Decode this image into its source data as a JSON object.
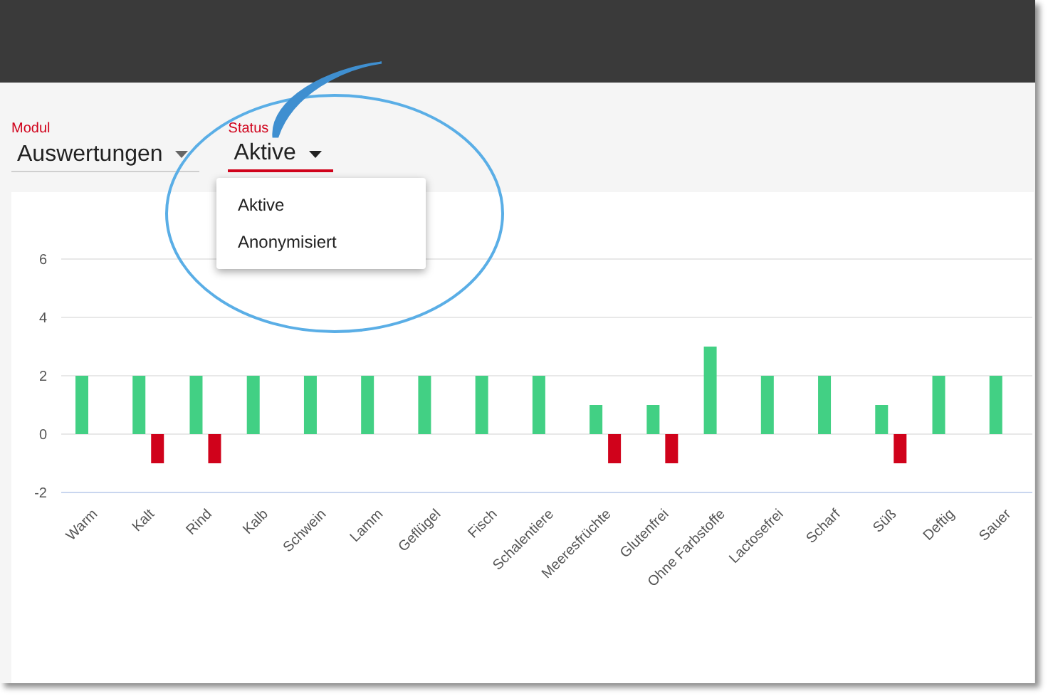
{
  "filters": [
    {
      "label": "Modul",
      "value": "Auswertungen",
      "focused": false
    },
    {
      "label": "Status",
      "value": "Aktive",
      "focused": true
    }
  ],
  "status_menu": {
    "items": [
      {
        "label": "Aktive"
      },
      {
        "label": "Anonymisiert"
      }
    ]
  },
  "chart_data": {
    "type": "bar",
    "categories": [
      "Warm",
      "Kalt",
      "Rind",
      "Kalb",
      "Schwein",
      "Lamm",
      "Geflügel",
      "Fisch",
      "Schalentiere",
      "Meeresfrüchte",
      "Glutenfrei",
      "Ohne Farbstoffe",
      "Lactosefrei",
      "Scharf",
      "Süß",
      "Deftig",
      "Sauer"
    ],
    "series": [
      {
        "color": "#42d084",
        "values": [
          2,
          2,
          2,
          2,
          2,
          2,
          2,
          2,
          2,
          1,
          1,
          3,
          2,
          2,
          1,
          2,
          2
        ]
      },
      {
        "color": "#d0021b",
        "values": [
          null,
          -1,
          -1,
          null,
          null,
          null,
          null,
          null,
          null,
          -1,
          -1,
          null,
          null,
          null,
          -1,
          null,
          null
        ]
      }
    ],
    "grid": true,
    "ylim": [
      -2,
      6
    ],
    "yticks": [
      -2,
      0,
      2,
      4,
      6
    ]
  }
}
